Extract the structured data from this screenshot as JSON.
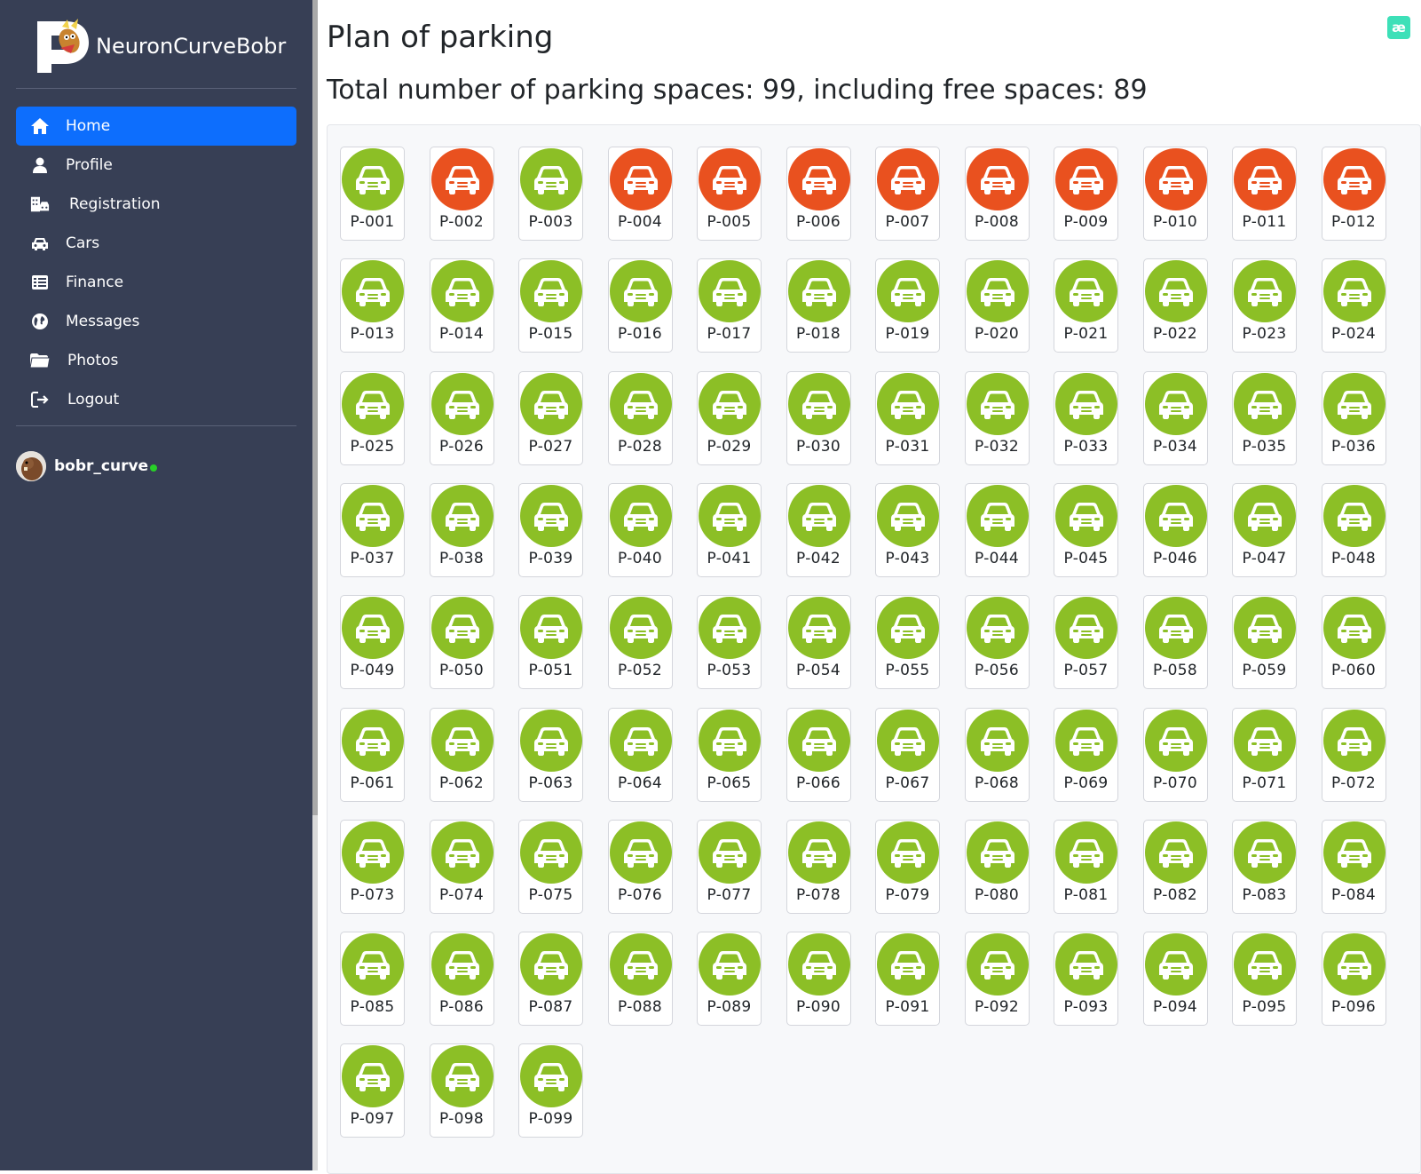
{
  "app": {
    "name": "NeuronCurveBobr"
  },
  "nav": [
    {
      "label": "Home",
      "icon": "home-icon",
      "active": true
    },
    {
      "label": "Profile",
      "icon": "user-icon",
      "active": false
    },
    {
      "label": "Registration",
      "icon": "building-car-icon",
      "active": false
    },
    {
      "label": "Cars",
      "icon": "car-icon",
      "active": false
    },
    {
      "label": "Finance",
      "icon": "list-table-icon",
      "active": false
    },
    {
      "label": "Messages",
      "icon": "globe-icon",
      "active": false
    },
    {
      "label": "Photos",
      "icon": "folder-icon",
      "active": false
    },
    {
      "label": "Logout",
      "icon": "logout-icon",
      "active": false
    }
  ],
  "user": {
    "name": "bobr_curve",
    "status": "online"
  },
  "page": {
    "title": "Plan of parking",
    "summary": "Total number of parking spaces: 99, including free spaces: 89",
    "corner_badge": "æ"
  },
  "parking": {
    "total": 99,
    "free": 89,
    "occupied_ids": [
      "P-002",
      "P-004",
      "P-005",
      "P-006",
      "P-007",
      "P-008",
      "P-009",
      "P-010",
      "P-011",
      "P-012"
    ],
    "colors": {
      "free": "#8cbf26",
      "occupied": "#e9511f"
    },
    "spaces": [
      "P-001",
      "P-002",
      "P-003",
      "P-004",
      "P-005",
      "P-006",
      "P-007",
      "P-008",
      "P-009",
      "P-010",
      "P-011",
      "P-012",
      "P-013",
      "P-014",
      "P-015",
      "P-016",
      "P-017",
      "P-018",
      "P-019",
      "P-020",
      "P-021",
      "P-022",
      "P-023",
      "P-024",
      "P-025",
      "P-026",
      "P-027",
      "P-028",
      "P-029",
      "P-030",
      "P-031",
      "P-032",
      "P-033",
      "P-034",
      "P-035",
      "P-036",
      "P-037",
      "P-038",
      "P-039",
      "P-040",
      "P-041",
      "P-042",
      "P-043",
      "P-044",
      "P-045",
      "P-046",
      "P-047",
      "P-048",
      "P-049",
      "P-050",
      "P-051",
      "P-052",
      "P-053",
      "P-054",
      "P-055",
      "P-056",
      "P-057",
      "P-058",
      "P-059",
      "P-060",
      "P-061",
      "P-062",
      "P-063",
      "P-064",
      "P-065",
      "P-066",
      "P-067",
      "P-068",
      "P-069",
      "P-070",
      "P-071",
      "P-072",
      "P-073",
      "P-074",
      "P-075",
      "P-076",
      "P-077",
      "P-078",
      "P-079",
      "P-080",
      "P-081",
      "P-082",
      "P-083",
      "P-084",
      "P-085",
      "P-086",
      "P-087",
      "P-088",
      "P-089",
      "P-090",
      "P-091",
      "P-092",
      "P-093",
      "P-094",
      "P-095",
      "P-096",
      "P-097",
      "P-098",
      "P-099"
    ]
  }
}
